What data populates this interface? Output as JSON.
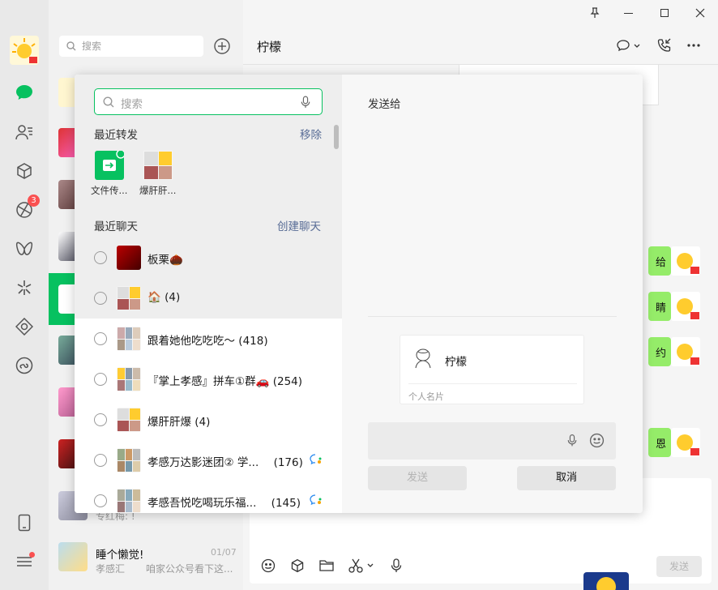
{
  "window": {
    "pin_icon": "pin-icon",
    "min_icon": "minimize-icon",
    "max_icon": "maximize-icon",
    "close_icon": "close-icon"
  },
  "sidebar": {
    "badge_moments": "3"
  },
  "list": {
    "search_placeholder": "搜索",
    "bottom_item": {
      "name": "睡个懒觉!",
      "time": "01/07",
      "preview_sender": "孝感汇",
      "preview": "咱家公众号看下这...",
      "partial_preview": "专红梅: !"
    }
  },
  "chat": {
    "title": "柠檬",
    "bubbles": [
      "给",
      "睛",
      "约",
      "恩"
    ],
    "send_label": "发送"
  },
  "dialog": {
    "search_placeholder": "搜索",
    "recent_forward": {
      "title": "最近转发",
      "action": "移除",
      "items": [
        {
          "label": "文件传..."
        },
        {
          "label": "爆肝肝..."
        }
      ]
    },
    "recent_chats": {
      "title": "最近聊天",
      "action": "创建聊天",
      "items": [
        {
          "name": "板栗",
          "suffix": "🌰",
          "count": ""
        },
        {
          "name": "🏠",
          "suffix": "",
          "count": "(4)"
        },
        {
          "name": "跟着她他吃吃吃～",
          "suffix": "",
          "count": "(418)"
        },
        {
          "name": "『掌上孝感』拼车①群🚗",
          "suffix": "",
          "count": "(254)"
        },
        {
          "name": "爆肝肝爆",
          "suffix": "",
          "count": "(4)"
        },
        {
          "name": "孝感万达影迷团② 学...",
          "suffix": "",
          "count": "(176)"
        },
        {
          "name": "孝感吾悦吃喝玩乐福...",
          "suffix": "",
          "count": "(145)"
        }
      ]
    },
    "send_to_title": "发送给",
    "card": {
      "name": "柠檬",
      "type": "个人名片"
    },
    "send_button": "发送",
    "cancel_button": "取消"
  },
  "colors": {
    "accent": "#07c160",
    "link": "#576b95",
    "bubble": "#95ec69",
    "badge": "#fa5151"
  }
}
